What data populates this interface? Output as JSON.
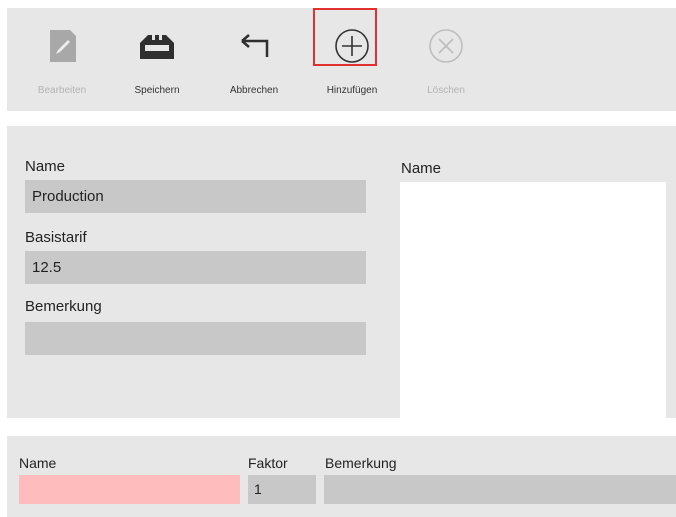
{
  "toolbar": {
    "buttons": [
      {
        "label": "Bearbeiten",
        "icon": "edit-icon",
        "enabled": false
      },
      {
        "label": "Speichern",
        "icon": "save-tray-icon",
        "enabled": true
      },
      {
        "label": "Abbrechen",
        "icon": "undo-arrow-icon",
        "enabled": true
      },
      {
        "label": "Hinzufügen",
        "icon": "add-circle-icon",
        "enabled": true,
        "highlighted": true
      },
      {
        "label": "Löschen",
        "icon": "delete-circle-icon",
        "enabled": false
      }
    ]
  },
  "form": {
    "name_label": "Name",
    "name_value": "Production",
    "basistarif_label": "Basistarif",
    "basistarif_value": "12.5",
    "bemerkung_label": "Bemerkung",
    "bemerkung_value": "",
    "list_header": "Name"
  },
  "grid": {
    "headers": {
      "name": "Name",
      "faktor": "Faktor",
      "bemerkung": "Bemerkung"
    },
    "row": {
      "name": "",
      "faktor": "1",
      "bemerkung": ""
    }
  },
  "colors": {
    "panel_bg": "#e7e7e7",
    "field_bg": "#c8c8c8",
    "error_field_bg": "#ffbcbc",
    "highlight_border": "#e03030"
  }
}
